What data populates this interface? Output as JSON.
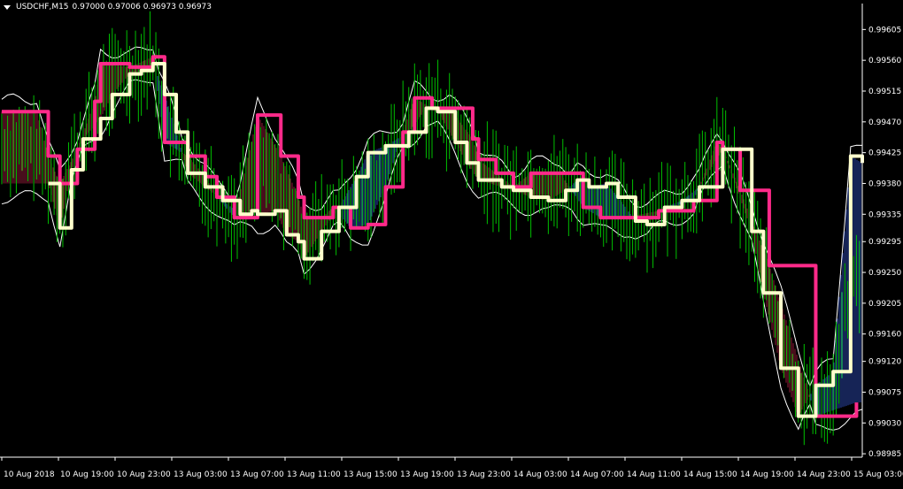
{
  "window": {
    "symbol_tf": "USDCHF,M15",
    "ohlc": "0.97000 0.97006 0.96973 0.96973"
  },
  "colors": {
    "background": "#000000",
    "axis": "#ffffff",
    "bars": "#00c000",
    "upper_line": "#ff2a8a",
    "lower_line": "#ffffcc",
    "envelope": "#ffffff",
    "cloud_up": "#3050c0",
    "cloud_down": "#a02040"
  },
  "chart_data": {
    "type": "line",
    "title": "USDCHF,M15",
    "y_ticks": [
      "0.99605",
      "0.99560",
      "0.99515",
      "0.99470",
      "0.99425",
      "0.99380",
      "0.99335",
      "0.99295",
      "0.99250",
      "0.99205",
      "0.99160",
      "0.99120",
      "0.99075",
      "0.99030",
      "0.98985"
    ],
    "x_ticks": [
      "10 Aug 2018",
      "10 Aug 19:00",
      "10 Aug 23:00",
      "13 Aug 03:00",
      "13 Aug 07:00",
      "13 Aug 11:00",
      "13 Aug 15:00",
      "13 Aug 19:00",
      "13 Aug 23:00",
      "14 Aug 03:00",
      "14 Aug 07:00",
      "14 Aug 11:00",
      "14 Aug 15:00",
      "14 Aug 19:00",
      "14 Aug 23:00",
      "15 Aug 03:00"
    ],
    "ylim": [
      0.9898,
      0.9963
    ],
    "x_index_range": [
      0,
      148
    ],
    "series": [
      {
        "role": "upper-stepline",
        "x": [
          0,
          6,
          8,
          10,
          13,
          16,
          17,
          22,
          26,
          28,
          32,
          35,
          37,
          40,
          44,
          48,
          51,
          52,
          55,
          57,
          60,
          63,
          66,
          69,
          71,
          74,
          77,
          81,
          82,
          85,
          88,
          91,
          96,
          100,
          103,
          105,
          107,
          113,
          119,
          123,
          124,
          127,
          132,
          140,
          147
        ],
        "y": [
          0.99485,
          0.99485,
          0.9942,
          0.9938,
          0.9943,
          0.995,
          0.99555,
          0.9955,
          0.99565,
          0.9944,
          0.9942,
          0.9939,
          0.9936,
          0.9933,
          0.9948,
          0.9942,
          0.9936,
          0.9933,
          0.9933,
          0.99345,
          0.99315,
          0.9932,
          0.99375,
          0.99455,
          0.99505,
          0.9949,
          0.9949,
          0.99445,
          0.99415,
          0.99395,
          0.99375,
          0.99395,
          0.99395,
          0.99345,
          0.9933,
          0.9933,
          0.9933,
          0.9934,
          0.99355,
          0.9944,
          0.9943,
          0.9937,
          0.9926,
          0.9904,
          0.9906
        ]
      },
      {
        "role": "lower-stepline",
        "x": [
          8,
          10,
          12,
          14,
          17,
          19,
          22,
          24,
          26,
          28,
          30,
          32,
          35,
          38,
          41,
          43,
          44,
          47,
          49,
          51,
          52,
          55,
          58,
          61,
          63,
          66,
          70,
          73,
          75,
          78,
          80,
          82,
          86,
          88,
          91,
          94,
          97,
          99,
          101,
          104,
          106,
          109,
          111,
          114,
          117,
          120,
          124,
          129,
          131,
          134,
          137,
          140,
          143,
          146,
          148
        ],
        "y": [
          0.9938,
          0.99315,
          0.994,
          0.99445,
          0.99475,
          0.9951,
          0.9954,
          0.99545,
          0.99555,
          0.9951,
          0.99455,
          0.99395,
          0.99375,
          0.99355,
          0.99335,
          0.9934,
          0.99335,
          0.9934,
          0.99305,
          0.99295,
          0.9927,
          0.9931,
          0.99345,
          0.9939,
          0.99425,
          0.99435,
          0.99455,
          0.9949,
          0.99485,
          0.9944,
          0.9941,
          0.99385,
          0.99375,
          0.9937,
          0.9936,
          0.99355,
          0.9937,
          0.99385,
          0.99375,
          0.9938,
          0.9936,
          0.99325,
          0.9932,
          0.99345,
          0.99355,
          0.99375,
          0.9943,
          0.9931,
          0.9922,
          0.9911,
          0.9904,
          0.99085,
          0.99105,
          0.9942,
          0.9941
        ]
      }
    ],
    "candles_summary": "green OHLC bars",
    "grid": false,
    "legend": "none"
  }
}
